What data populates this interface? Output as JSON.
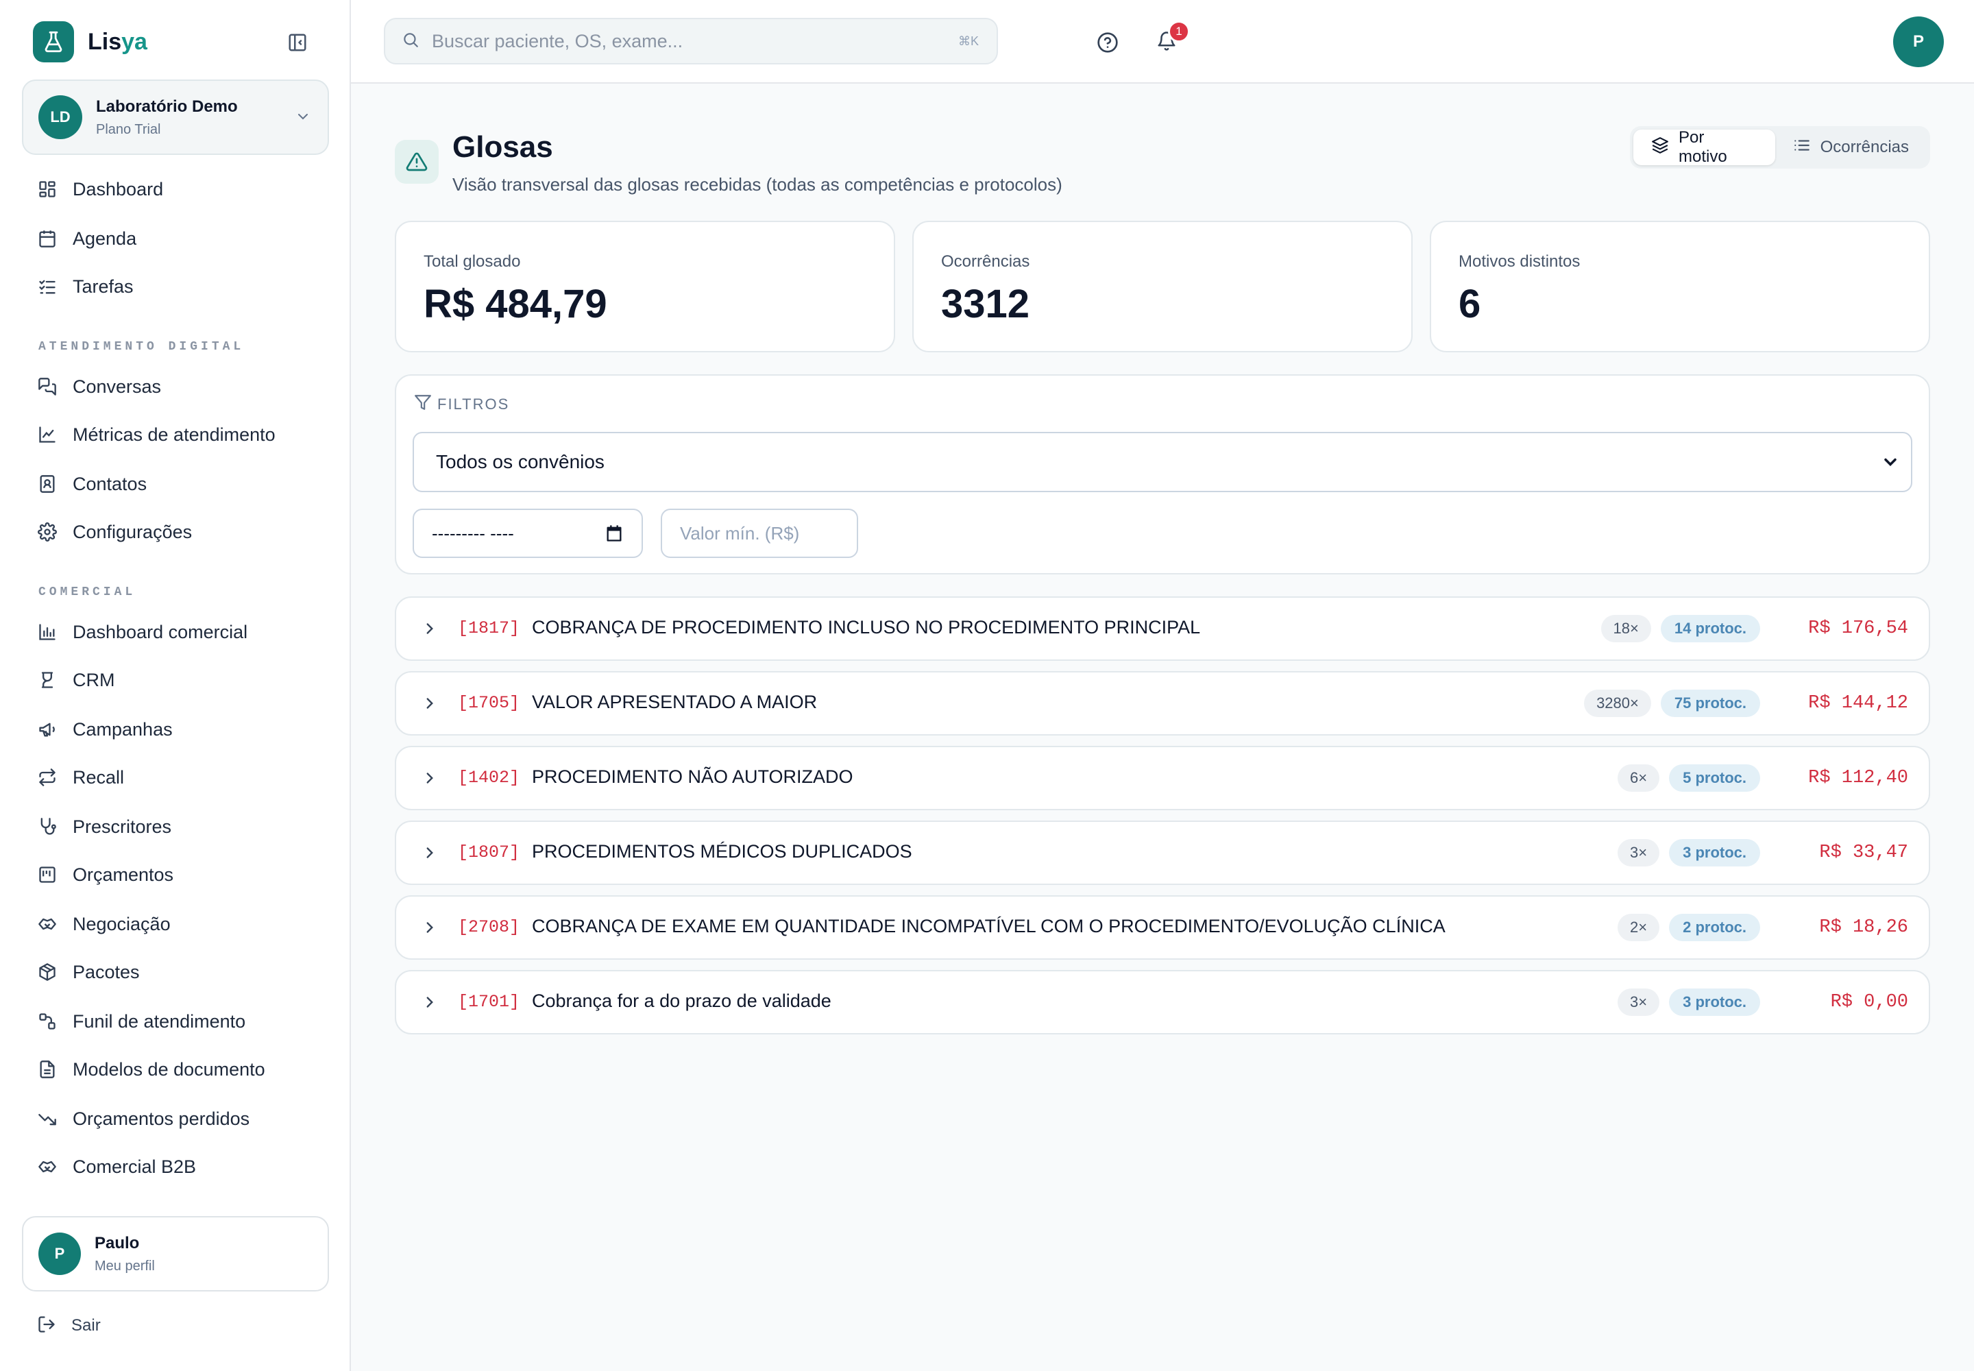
{
  "brand": {
    "name_main": "Lis",
    "name_accent": "ya"
  },
  "organization": {
    "initials": "LD",
    "name": "Laboratório Demo",
    "plan": "Plano Trial"
  },
  "sidebar": {
    "items_top": [
      {
        "label": "Dashboard",
        "icon": "dashboard-icon"
      },
      {
        "label": "Agenda",
        "icon": "calendar-icon"
      },
      {
        "label": "Tarefas",
        "icon": "tasks-icon"
      }
    ],
    "section_digital": "ATENDIMENTO DIGITAL",
    "items_digital": [
      {
        "label": "Conversas",
        "icon": "chat-icon"
      },
      {
        "label": "Métricas de atendimento",
        "icon": "line-chart-icon"
      },
      {
        "label": "Contatos",
        "icon": "contacts-icon"
      },
      {
        "label": "Configurações",
        "icon": "gear-icon"
      }
    ],
    "section_comercial": "COMERCIAL",
    "items_comercial": [
      {
        "label": "Dashboard comercial",
        "icon": "bar-chart-icon"
      },
      {
        "label": "CRM",
        "icon": "crm-icon"
      },
      {
        "label": "Campanhas",
        "icon": "megaphone-icon"
      },
      {
        "label": "Recall",
        "icon": "repeat-icon"
      },
      {
        "label": "Prescritores",
        "icon": "stethoscope-icon"
      },
      {
        "label": "Orçamentos",
        "icon": "quote-icon"
      },
      {
        "label": "Negociação",
        "icon": "handshake-icon"
      },
      {
        "label": "Pacotes",
        "icon": "package-icon"
      },
      {
        "label": "Funil de atendimento",
        "icon": "funnel-icon"
      },
      {
        "label": "Modelos de documento",
        "icon": "document-icon"
      },
      {
        "label": "Orçamentos perdidos",
        "icon": "trending-down-icon"
      },
      {
        "label": "Comercial B2B",
        "icon": "handshake-icon"
      }
    ]
  },
  "user": {
    "initial": "P",
    "name": "Paulo",
    "subtitle": "Meu perfil"
  },
  "logout_label": "Sair",
  "search": {
    "placeholder": "Buscar paciente, OS, exame...",
    "shortcut": "⌘K"
  },
  "notifications": {
    "count": "1"
  },
  "top_avatar_initial": "P",
  "page": {
    "title": "Glosas",
    "subtitle": "Visão transversal das glosas recebidas (todas as competências e protocolos)"
  },
  "view_toggle": {
    "by_reason": "Por motivo",
    "occurrences": "Ocorrências",
    "active": "by_reason"
  },
  "stats": [
    {
      "label": "Total glosado",
      "value": "R$ 484,79"
    },
    {
      "label": "Ocorrências",
      "value": "3312"
    },
    {
      "label": "Motivos distintos",
      "value": "6"
    }
  ],
  "filters": {
    "heading": "FILTROS",
    "convenio_selected": "Todos os convênios",
    "date_value": "--------- ----",
    "min_value_placeholder": "Valor mín. (R$)"
  },
  "glosas": [
    {
      "code": "[1817]",
      "title": "COBRANÇA DE PROCEDIMENTO INCLUSO NO PROCEDIMENTO PRINCIPAL",
      "count": "18×",
      "protocols": "14 protoc.",
      "amount": "R$ 176,54"
    },
    {
      "code": "[1705]",
      "title": "VALOR APRESENTADO A MAIOR",
      "count": "3280×",
      "protocols": "75 protoc.",
      "amount": "R$ 144,12"
    },
    {
      "code": "[1402]",
      "title": "PROCEDIMENTO NÃO AUTORIZADO",
      "count": "6×",
      "protocols": "5 protoc.",
      "amount": "R$ 112,40"
    },
    {
      "code": "[1807]",
      "title": "PROCEDIMENTOS MÉDICOS DUPLICADOS",
      "count": "3×",
      "protocols": "3 protoc.",
      "amount": "R$ 33,47"
    },
    {
      "code": "[2708]",
      "title": "COBRANÇA DE EXAME EM QUANTIDADE INCOMPATÍVEL COM O PROCEDIMENTO/EVOLUÇÃO CLÍNICA",
      "count": "2×",
      "protocols": "2 protoc.",
      "amount": "R$ 18,26"
    },
    {
      "code": "[1701]",
      "title": "Cobrança for a do prazo de validade",
      "count": "3×",
      "protocols": "3 protoc.",
      "amount": "R$ 0,00"
    }
  ],
  "colors": {
    "brand": "#137c74",
    "accent": "#16958a",
    "danger": "#d12d3f",
    "protocol_pill": "#4a86b4"
  }
}
